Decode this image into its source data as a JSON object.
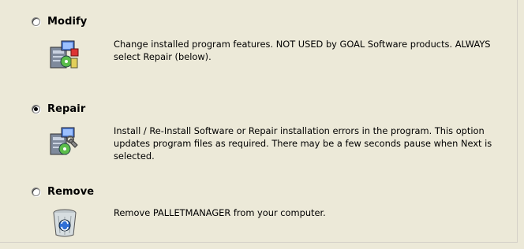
{
  "options": [
    {
      "label": "Modify",
      "icon": "modify-program-icon",
      "selected": false,
      "description": "Change installed program features. NOT USED by GOAL Software products. ALWAYS select Repair (below)."
    },
    {
      "label": "Repair",
      "icon": "repair-program-icon",
      "selected": true,
      "description": "Install / Re-Install Software or Repair installation errors in the program. This option updates program files as required. There may be a few seconds pause when Next is selected."
    },
    {
      "label": "Remove",
      "icon": "remove-program-icon",
      "selected": false,
      "description": "Remove PALLETMANAGER from your computer."
    }
  ],
  "colors": {
    "background": "#ece9d8"
  }
}
